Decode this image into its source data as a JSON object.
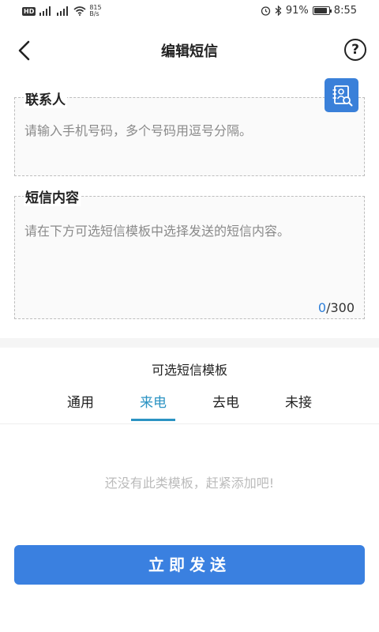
{
  "status_bar": {
    "hd_badge": "HD",
    "net_speed_value": "815",
    "net_speed_unit": "B/s",
    "battery_text": "91%",
    "battery_level": 0.91,
    "time": "8:55"
  },
  "header": {
    "title": "编辑短信",
    "help_glyph": "?"
  },
  "contact": {
    "label": "联系人",
    "placeholder": "请输入手机号码，多个号码用逗号分隔。"
  },
  "content": {
    "label": "短信内容",
    "placeholder": "请在下方可选短信模板中选择发送的短信内容。",
    "count_current": "0",
    "count_max": "/300"
  },
  "templates": {
    "title": "可选短信模板",
    "tabs": [
      {
        "label": "通用"
      },
      {
        "label": "来电"
      },
      {
        "label": "去电"
      },
      {
        "label": "未接"
      }
    ],
    "active_tab": 1,
    "empty_message": "还没有此类模板，赶紧添加吧!"
  },
  "send_button": {
    "label": "立即发送"
  },
  "colors": {
    "accent": "#3a80e0",
    "tab_active": "#2b93c3"
  }
}
